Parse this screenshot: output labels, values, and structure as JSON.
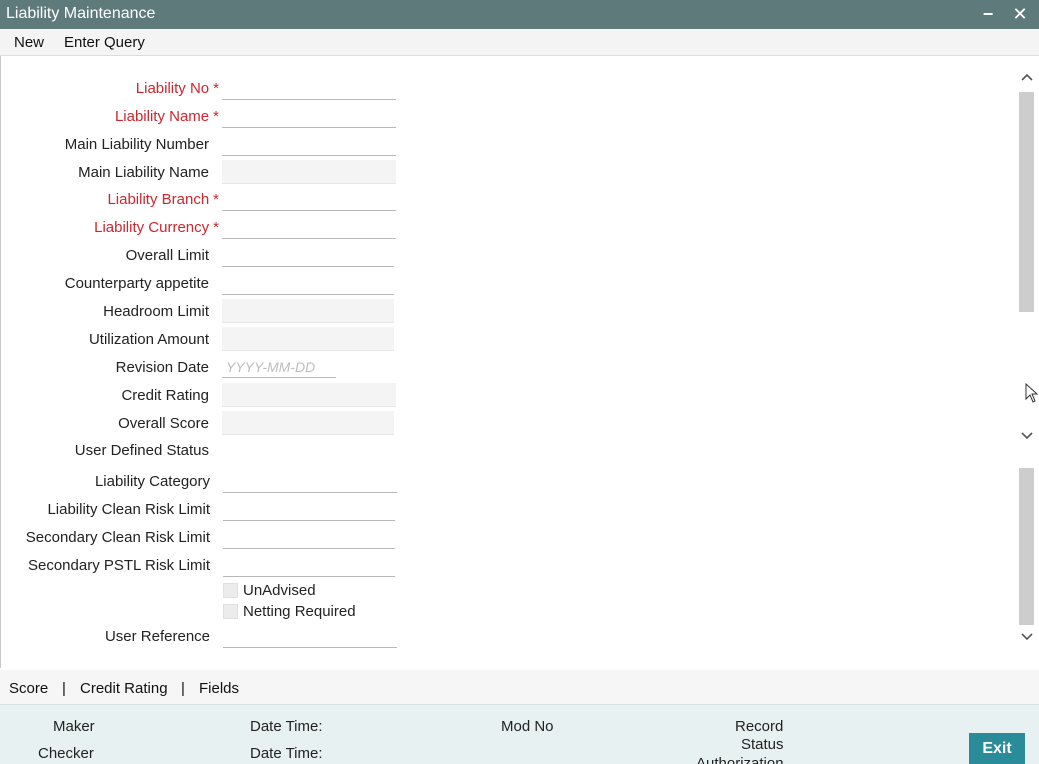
{
  "window": {
    "title": "Liability Maintenance",
    "minimize_glyph": "−",
    "close_glyph": "✕"
  },
  "menu": {
    "new_label": "New",
    "enter_query_label": "Enter Query"
  },
  "form": {
    "liability_no": {
      "label": "Liability No",
      "value": "",
      "required": "*"
    },
    "liability_name": {
      "label": "Liability Name",
      "value": "",
      "required": "*"
    },
    "main_liability_number": {
      "label": "Main Liability Number",
      "value": ""
    },
    "main_liability_name": {
      "label": "Main Liability Name",
      "value": ""
    },
    "liability_branch": {
      "label": "Liability Branch",
      "value": "",
      "required": "*"
    },
    "liability_currency": {
      "label": "Liability Currency",
      "value": "",
      "required": "*"
    },
    "overall_limit": {
      "label": "Overall Limit",
      "value": ""
    },
    "counterparty_appetite": {
      "label": "Counterparty appetite",
      "value": ""
    },
    "headroom_limit": {
      "label": "Headroom Limit",
      "value": ""
    },
    "utilization_amount": {
      "label": "Utilization Amount",
      "value": ""
    },
    "revision_date": {
      "label": "Revision Date",
      "value": "",
      "placeholder": "YYYY-MM-DD"
    },
    "credit_rating": {
      "label": "Credit Rating",
      "value": ""
    },
    "overall_score": {
      "label": "Overall Score",
      "value": ""
    },
    "user_defined_status": {
      "label": "User Defined Status"
    },
    "liability_category": {
      "label": "Liability Category",
      "value": ""
    },
    "liability_clean_risk_limit": {
      "label": "Liability Clean Risk Limit",
      "value": ""
    },
    "secondary_clean_risk_limit": {
      "label": "Secondary Clean Risk Limit",
      "value": ""
    },
    "secondary_pstl_risk_limit": {
      "label": "Secondary PSTL Risk Limit",
      "value": ""
    },
    "unadvised": {
      "label": "UnAdvised",
      "checked": false
    },
    "netting_required": {
      "label": "Netting Required",
      "checked": false
    },
    "user_reference": {
      "label": "User Reference",
      "value": ""
    }
  },
  "tabs": {
    "score": "Score",
    "credit_rating": "Credit Rating",
    "fields": "Fields",
    "separator": "|"
  },
  "footer": {
    "maker": "Maker",
    "checker": "Checker",
    "date_time_1": "Date Time:",
    "date_time_2": "Date Time:",
    "mod_no": "Mod No",
    "record_status_line1": "Record",
    "record_status_line2": "Status",
    "authorization_status": "Authorization",
    "exit_label": "Exit"
  },
  "colors": {
    "titlebar": "#5f7a7b",
    "required_label": "#d0252d",
    "footer_bg": "#e7f1f1",
    "exit_button": "#2a8c98"
  }
}
